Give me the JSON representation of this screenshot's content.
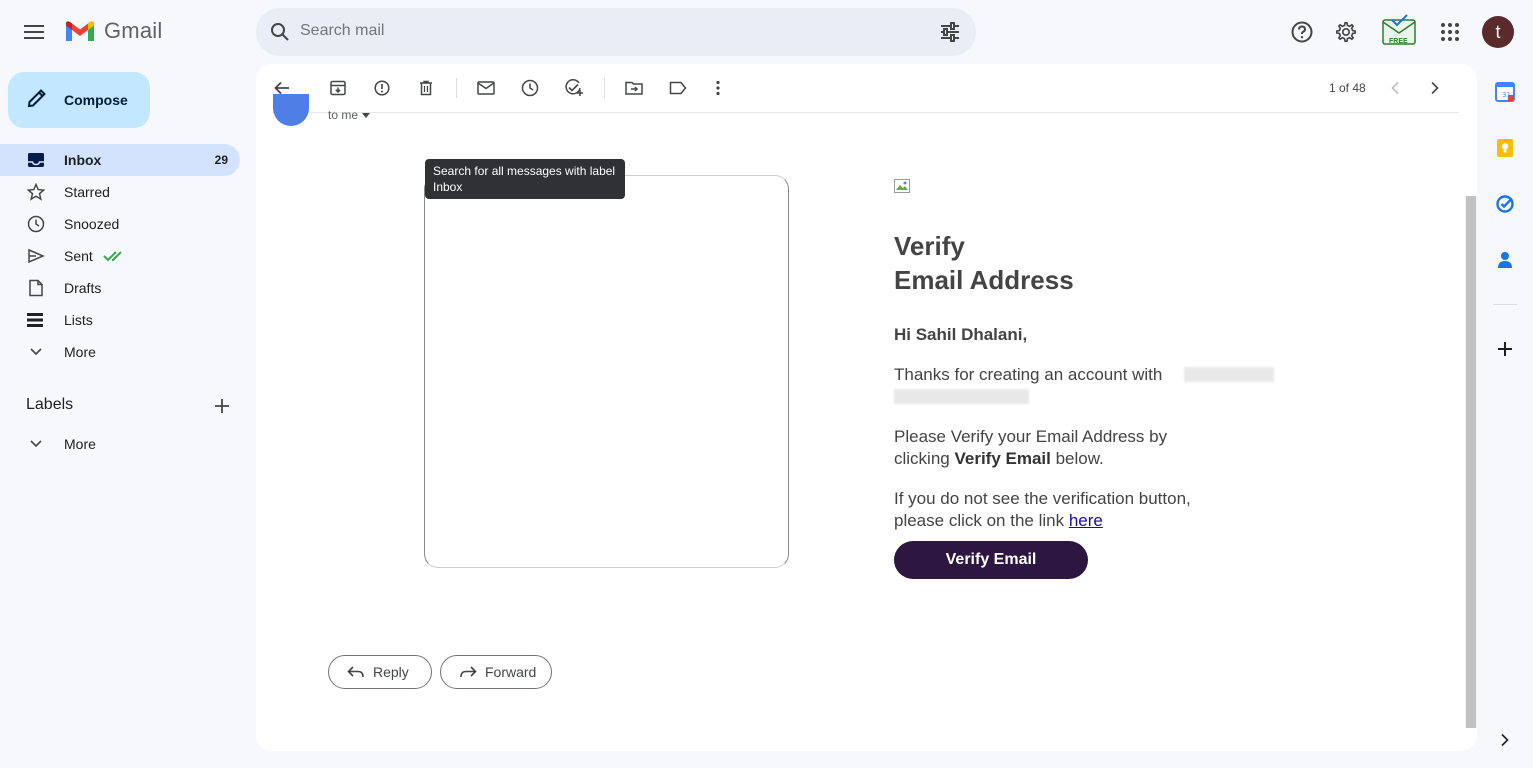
{
  "app": {
    "name": "Gmail"
  },
  "search": {
    "placeholder": "Search mail"
  },
  "sidebar": {
    "compose_label": "Compose",
    "items": [
      {
        "label": "Inbox",
        "count": "29",
        "icon": "inbox-icon",
        "active": true
      },
      {
        "label": "Starred",
        "icon": "star-icon"
      },
      {
        "label": "Snoozed",
        "icon": "clock-icon"
      },
      {
        "label": "Sent",
        "icon": "send-icon"
      },
      {
        "label": "Drafts",
        "icon": "draft-icon"
      },
      {
        "label": "Lists",
        "icon": "list-icon"
      },
      {
        "label": "More",
        "icon": "chevron-down-icon"
      }
    ],
    "labels_heading": "Labels",
    "labels_more": "More"
  },
  "header": {
    "extension_badge": "FREE",
    "avatar_letter": "t"
  },
  "toolbar": {
    "pager": "1 of 48"
  },
  "message": {
    "recipient": "to me",
    "tooltip": "Search for all messages with label Inbox",
    "title_line1": "Verify",
    "title_line2": "Email Address",
    "greeting": "Hi Sahil Dhalani,",
    "thanks_text": "Thanks for creating an account with",
    "please_verify_1": "Please Verify your Email Address by clicking ",
    "please_verify_bold": "Verify Email",
    "please_verify_2": " below.",
    "fallback_text": "If you do not see the verification button, please click on the link ",
    "fallback_link": "here",
    "verify_button": "Verify Email"
  },
  "actions": {
    "reply": "Reply",
    "forward": "Forward"
  },
  "colors": {
    "accent": "#c2e7ff",
    "active_nav": "#d3e3fd",
    "verify_button": "#2d1740",
    "sent_check": "#34a853"
  }
}
